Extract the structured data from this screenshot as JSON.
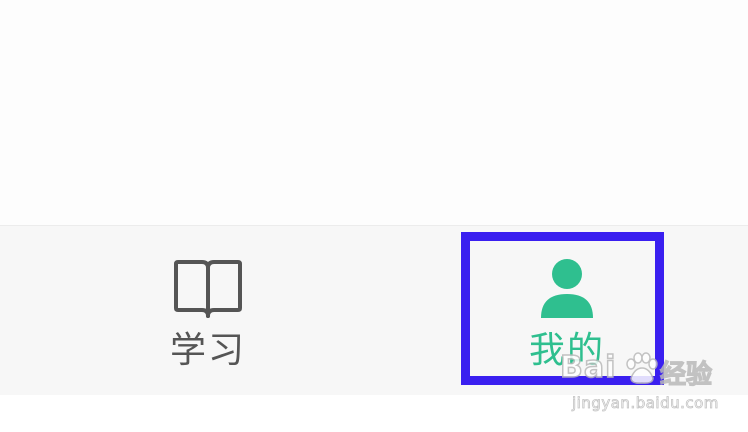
{
  "tabbar": {
    "tabs": [
      {
        "label": "学习",
        "icon": "book-icon",
        "active": false
      },
      {
        "label": "我的",
        "icon": "person-icon",
        "active": true
      }
    ]
  },
  "colors": {
    "active": "#2fbf8f",
    "inactive": "#555555",
    "highlight_border": "#3a1ff0",
    "tabbar_background": "#f7f7f7"
  },
  "watermark": {
    "logo_text": "Bai",
    "suffix": "经验",
    "url": "jingyan.baidu.com"
  }
}
